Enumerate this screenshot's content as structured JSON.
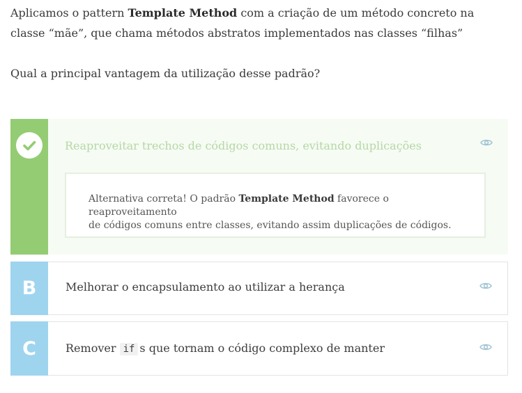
{
  "question": {
    "line1_before": "Aplicamos o pattern ",
    "line1_bold": "Template Method",
    "line1_after": " com a criação de um método concreto na",
    "line2": "classe “mãe”, que chama métodos abstratos implementados nas classes “filhas”",
    "prompt": "Qual a principal vantagem da utilização desse padrão?"
  },
  "alternatives": [
    {
      "marker": "check",
      "text": "Reaproveitar trechos de códigos comuns, evitando duplicações",
      "status": "correct",
      "feedback": {
        "before": "Alternativa correta! O padrão ",
        "bold": "Template Method",
        "after_line1": " favorece o reaproveitamento",
        "line2": "de códigos comuns entre classes, evitando assim duplicações de códigos."
      }
    },
    {
      "marker": "B",
      "text": "Melhorar o encapsulamento ao utilizar a herança"
    },
    {
      "marker": "C",
      "code": "if",
      "text_after": "s que tornam o código complexo de manter",
      "text_before": "Remover "
    }
  ],
  "icons": {
    "check": "check-icon",
    "eye": "eye-icon"
  },
  "colors": {
    "correct_marker": "#94cc73",
    "correct_text": "#b5d8a5",
    "correct_bg": "#f6fbf4",
    "letter_marker": "#9fd4ef",
    "eye_icon": "#9fc3d3"
  }
}
